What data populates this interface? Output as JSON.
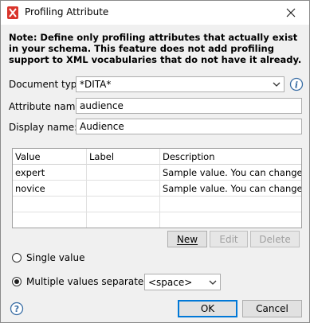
{
  "window": {
    "title": "Profiling Attribute"
  },
  "note": "Note: Define only profiling attributes that actually exist in your schema. This feature does not add profiling support to XML vocabularies that do not have it already.",
  "form": {
    "document_type_label": "Document type:",
    "document_type_value": "*DITA*",
    "attribute_name_label": "Attribute name:",
    "attribute_name_value": "audience",
    "display_name_label": "Display name:",
    "display_name_value": "Audience"
  },
  "table": {
    "columns": [
      "Value",
      "Label",
      "Description"
    ],
    "rows": [
      {
        "value": "expert",
        "label": "",
        "description": "Sample value. You can change it ..."
      },
      {
        "value": "novice",
        "label": "",
        "description": "Sample value. You can change it ..."
      }
    ]
  },
  "table_buttons": {
    "new": "New",
    "edit": "Edit",
    "delete": "Delete"
  },
  "options": {
    "single_value_label": "Single value",
    "single_value_selected": false,
    "multiple_values_label": "Multiple values separated by:",
    "multiple_values_selected": true,
    "separator_value": "<space>"
  },
  "footer": {
    "ok": "OK",
    "cancel": "Cancel"
  },
  "icons": {
    "app": "oxygen-app-icon",
    "close": "close-icon",
    "info": "info-icon",
    "help": "help-icon",
    "dropdown": "chevron-down-icon"
  },
  "colors": {
    "accent": "#0078d7",
    "app_icon": "#d9342b"
  }
}
